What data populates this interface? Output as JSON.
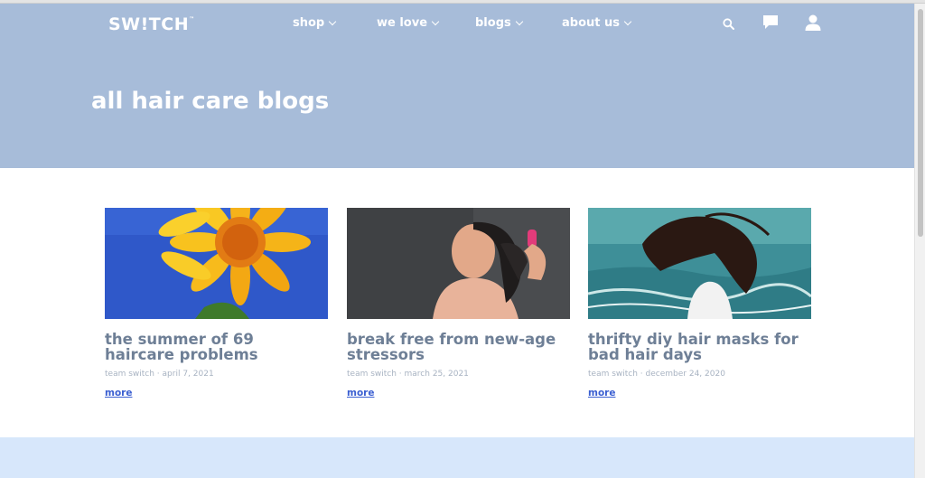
{
  "header": {
    "logo": "SW!TCH",
    "logo_tm": "™",
    "nav": [
      {
        "label": "shop"
      },
      {
        "label": "we love"
      },
      {
        "label": "blogs"
      },
      {
        "label": "about us"
      }
    ]
  },
  "hero": {
    "title": "all hair care blogs"
  },
  "cards": [
    {
      "title": "the summer of 69 haircare problems",
      "meta": "team switch · april 7, 2021",
      "more": "more",
      "image": "sunflower"
    },
    {
      "title": "break free from new-age stressors",
      "meta": "team switch · march 25, 2021",
      "more": "more",
      "image": "woman-brushing-hair"
    },
    {
      "title": "thrifty diy hair masks for bad hair days",
      "meta": "team switch · december 24, 2020",
      "more": "more",
      "image": "woman-hair-sea"
    }
  ],
  "icons": [
    "search-icon",
    "chat-icon",
    "user-icon",
    "chevron-down-icon"
  ],
  "colors": {
    "hero": "#a7bcd9",
    "title": "#6e7f96",
    "meta": "#a8b3c2",
    "link": "#3b5fd1",
    "footer": "#d7e7fb"
  }
}
